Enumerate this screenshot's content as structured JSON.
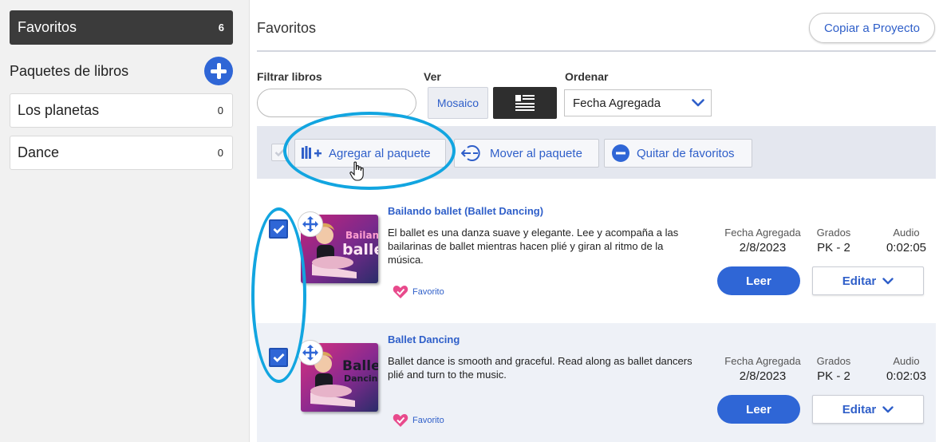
{
  "sidebar": {
    "favorites": {
      "label": "Favoritos",
      "count": "6"
    },
    "packages_title": "Paquetes de libros",
    "packages": [
      {
        "label": "Los planetas",
        "count": "0"
      },
      {
        "label": "Dance",
        "count": "0"
      }
    ]
  },
  "main": {
    "title": "Favoritos",
    "copy_button": "Copiar a Proyecto",
    "filter": {
      "label": "Filtrar libros",
      "value": "",
      "placeholder": ""
    },
    "view": {
      "label": "Ver",
      "mosaic_label": "Mosaico"
    },
    "sort": {
      "label": "Ordenar",
      "selected": "Fecha Agregada"
    }
  },
  "toolbar": {
    "add_to_package": "Agregar al paquete",
    "move_to_package": "Mover al paquete",
    "remove_favorites": "Quitar de favoritos"
  },
  "books": [
    {
      "title": "Bailando ballet (Ballet Dancing)",
      "description": "El ballet es una danza suave y elegante. Lee y acompaña a las bailarinas de ballet mientras hacen plié y giran al ritmo de la música.",
      "cover_text_1": "Bailando",
      "cover_text_2": "ballet",
      "favorite_label": "Favorito",
      "date_header": "Fecha Agregada",
      "date": "2/8/2023",
      "grades_header": "Grados",
      "grades": "PK - 2",
      "audio_header": "Audio",
      "audio": "0:02:05",
      "read_label": "Leer",
      "edit_label": "Editar",
      "checked": true
    },
    {
      "title": "Ballet Dancing",
      "description": "Ballet dance is smooth and graceful. Read along as ballet dancers plié and turn to the music.",
      "cover_text_1": "Ballet",
      "cover_text_2": "Dancing",
      "favorite_label": "Favorito",
      "date_header": "Fecha Agregada",
      "date": "2/8/2023",
      "grades_header": "Grados",
      "grades": "PK - 2",
      "audio_header": "Audio",
      "audio": "0:02:03",
      "read_label": "Leer",
      "edit_label": "Editar",
      "checked": true
    }
  ],
  "colors": {
    "accent": "#2f66d6",
    "link": "#2f5fc9",
    "callout": "#12a5e0",
    "sidebar_active": "#3b3b3b"
  }
}
